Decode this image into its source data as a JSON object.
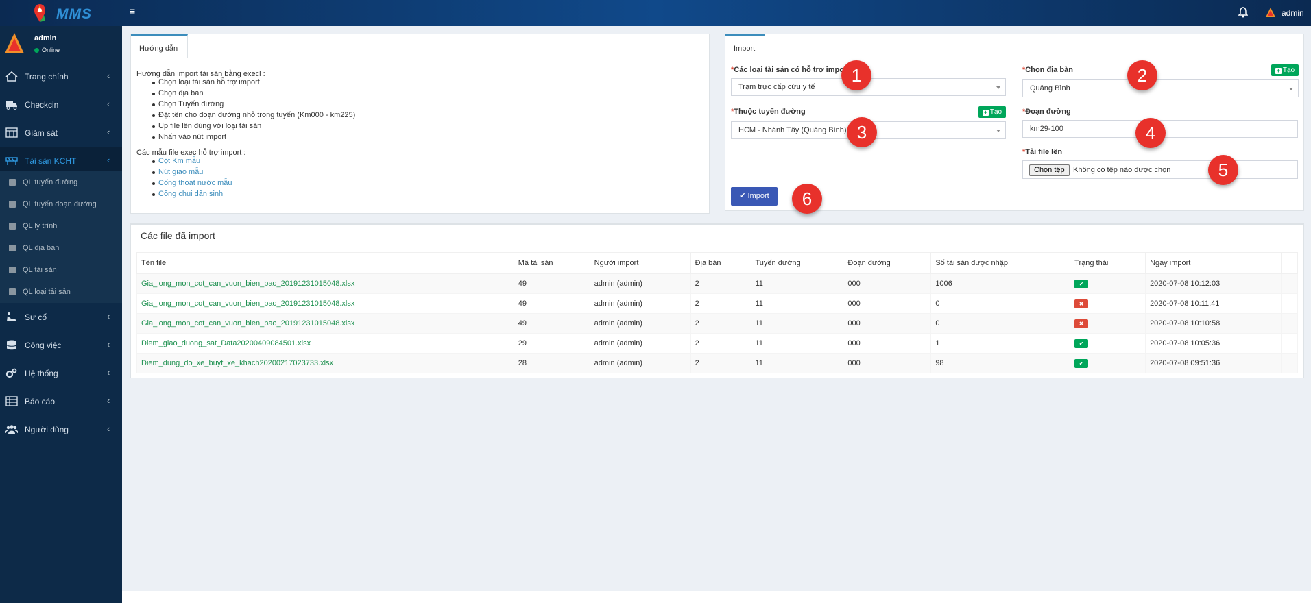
{
  "header": {
    "logo_text": "MMS",
    "user_name": "admin",
    "icons": {
      "menu": "hamburger-icon",
      "bell": "bell-icon",
      "avatar": "avatar-triangle-icon"
    }
  },
  "sidebar": {
    "user": {
      "name": "admin",
      "status": "Online"
    },
    "items": [
      {
        "label": "Trang chính",
        "icon": "home-icon",
        "active": false
      },
      {
        "label": "Checkcin",
        "icon": "truck-icon",
        "active": false
      },
      {
        "label": "Giám sát",
        "icon": "monitor-icon",
        "active": false
      },
      {
        "label": "Tài sản KCHT",
        "icon": "road-barrier-icon",
        "active": true
      },
      {
        "label": "Sự cố",
        "icon": "incident-icon",
        "active": false
      },
      {
        "label": "Công việc",
        "icon": "database-icon",
        "active": false
      },
      {
        "label": "Hệ thống",
        "icon": "cogs-icon",
        "active": false
      },
      {
        "label": "Báo cáo",
        "icon": "table-icon",
        "active": false
      },
      {
        "label": "Người dùng",
        "icon": "users-icon",
        "active": false
      }
    ],
    "submenu": [
      "QL tuyến đường",
      "QL tuyến đoạn đường",
      "QL lý trình",
      "QL địa bàn",
      "QL tài sản",
      "QL loại tài sản"
    ]
  },
  "guide": {
    "tab": "Hướng dẫn",
    "title": "Hướng dẫn import tài sản bằng execl :",
    "steps": [
      "Chọn loại tài sản hỗ trợ import",
      "Chọn địa bàn",
      "Chọn Tuyến đường",
      "Đặt tên cho đoạn đường nhỏ trong tuyến (Km000 - km225)",
      "Up file lên đúng với loại tài sản",
      "Nhấn vào nút import"
    ],
    "samples_title": "Các mẫu file exec hỗ trợ import :",
    "samples": [
      "Cột Km mẫu",
      "Nút giao mẫu",
      "Cống thoát nước mẫu",
      "Cống chui dân sinh"
    ]
  },
  "import_form": {
    "tab": "Import",
    "asset_type_label": "Các loại tài sản có hỗ trợ import",
    "asset_type_value": "Trạm trực cấp cứu y tế",
    "area_label": "Chọn địa bàn",
    "area_value": "Quảng Bình",
    "route_label": "Thuộc tuyến đường",
    "route_value": "HCM - Nhánh Tây (Quảng Bình)",
    "segment_label": "Đoạn đường",
    "segment_value": "km29-100",
    "upload_label": "Tải file lên",
    "file_button": "Chọn tệp",
    "file_status": "Không có tệp nào được chọn",
    "create_label": "Tạo",
    "import_button": "Import",
    "required_mark": "*",
    "step_badges": [
      "1",
      "2",
      "3",
      "4",
      "5",
      "6"
    ]
  },
  "imports": {
    "title": "Các file đã import",
    "columns": [
      "Tên file",
      "Mã tài sản",
      "Người import",
      "Địa bàn",
      "Tuyến đường",
      "Đoạn đường",
      "Số tài sản được nhập",
      "Trạng thái",
      "Ngày import"
    ],
    "rows": [
      {
        "file": "Gia_long_mon_cot_can_vuon_bien_bao_20191231015048.xlsx",
        "asset_code": "49",
        "user": "admin (admin)",
        "area": "2",
        "route": "11",
        "segment": "000",
        "count": "1006",
        "status": "success",
        "status_icon": "✔",
        "date": "2020-07-08 10:12:03"
      },
      {
        "file": "Gia_long_mon_cot_can_vuon_bien_bao_20191231015048.xlsx",
        "asset_code": "49",
        "user": "admin (admin)",
        "area": "2",
        "route": "11",
        "segment": "000",
        "count": "0",
        "status": "failed",
        "status_icon": "✖",
        "date": "2020-07-08 10:11:41"
      },
      {
        "file": "Gia_long_mon_cot_can_vuon_bien_bao_20191231015048.xlsx",
        "asset_code": "49",
        "user": "admin (admin)",
        "area": "2",
        "route": "11",
        "segment": "000",
        "count": "0",
        "status": "failed",
        "status_icon": "✖",
        "date": "2020-07-08 10:10:58"
      },
      {
        "file": "Diem_giao_duong_sat_Data20200409084501.xlsx",
        "asset_code": "29",
        "user": "admin (admin)",
        "area": "2",
        "route": "11",
        "segment": "000",
        "count": "1",
        "status": "success",
        "status_icon": "✔",
        "date": "2020-07-08 10:05:36"
      },
      {
        "file": "Diem_dung_do_xe_buyt_xe_khach20200217023733.xlsx",
        "asset_code": "28",
        "user": "admin (admin)",
        "area": "2",
        "route": "11",
        "segment": "000",
        "count": "98",
        "status": "success",
        "status_icon": "✔",
        "date": "2020-07-08 09:51:36"
      }
    ]
  },
  "colors": {
    "topbar": "#10498a",
    "sidebar": "#0d2a48",
    "accent": "#3c8dbc",
    "success": "#00a65a",
    "danger": "#dd4b39",
    "badge": "#e8312b",
    "import_button": "#3a58b5"
  }
}
